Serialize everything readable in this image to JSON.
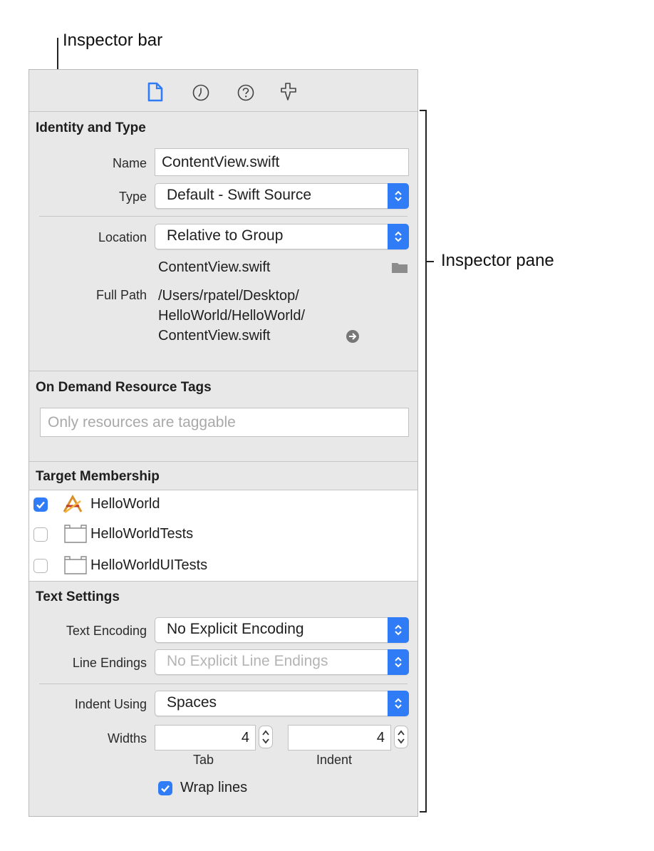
{
  "callouts": {
    "inspector_bar": "Inspector bar",
    "inspector_pane": "Inspector pane"
  },
  "inspector_bar": {
    "tabs": [
      {
        "icon": "file-icon",
        "active": true
      },
      {
        "icon": "clock-icon",
        "active": false
      },
      {
        "icon": "help-icon",
        "active": false
      },
      {
        "icon": "anchor-icon",
        "active": false
      }
    ],
    "accent_color": "#2f7cf6"
  },
  "identity": {
    "title": "Identity and Type",
    "name_label": "Name",
    "name_value": "ContentView.swift",
    "type_label": "Type",
    "type_value": "Default - Swift Source",
    "location_label": "Location",
    "location_value": "Relative to Group",
    "location_file": "ContentView.swift",
    "fullpath_label": "Full Path",
    "fullpath_lines": [
      "/Users/rpatel/Desktop/",
      "HelloWorld/HelloWorld/",
      "ContentView.swift"
    ]
  },
  "ondemand": {
    "title": "On Demand Resource Tags",
    "placeholder": "Only resources are taggable"
  },
  "membership": {
    "title": "Target Membership",
    "targets": [
      {
        "label": "HelloWorld",
        "checked": true,
        "icon": "app-target-icon"
      },
      {
        "label": "HelloWorldTests",
        "checked": false,
        "icon": "bundle-target-icon"
      },
      {
        "label": "HelloWorldUITests",
        "checked": false,
        "icon": "bundle-target-icon"
      }
    ]
  },
  "text_settings": {
    "title": "Text Settings",
    "encoding_label": "Text Encoding",
    "encoding_value": "No Explicit Encoding",
    "line_endings_label": "Line Endings",
    "line_endings_value": "No Explicit Line Endings",
    "indent_using_label": "Indent Using",
    "indent_using_value": "Spaces",
    "widths_label": "Widths",
    "tab_value": "4",
    "tab_caption": "Tab",
    "indent_value": "4",
    "indent_caption": "Indent",
    "wrap_label": "Wrap lines",
    "wrap_checked": true
  }
}
